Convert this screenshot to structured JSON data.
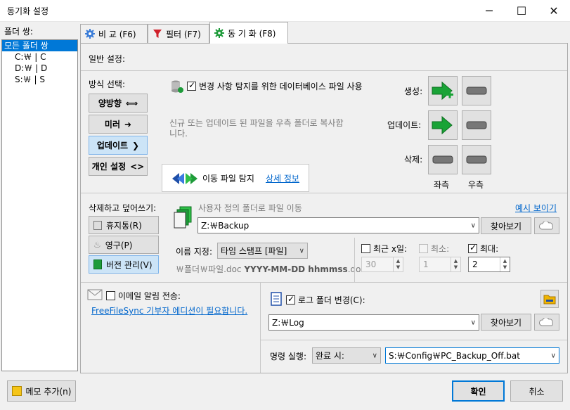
{
  "window": {
    "title": "동기화 설정",
    "minimize": "─",
    "maximize": "☐",
    "close": "✕"
  },
  "sidebar": {
    "label": "폴더 쌍:",
    "items": [
      "모든 폴더 쌍",
      "C:￦ | C",
      "D:￦ | D",
      "S:￦ | S"
    ]
  },
  "tabs": [
    {
      "label": "비  교 (F6)"
    },
    {
      "label": "필터 (F7)"
    },
    {
      "label": "동 기 화 (F8)"
    }
  ],
  "general": {
    "label": "일반 설정:"
  },
  "method": {
    "label": "방식 선택:",
    "buttons": [
      {
        "label": "양방향",
        "glyph": "⟺"
      },
      {
        "label": "미러",
        "glyph": "➜"
      },
      {
        "label": "업데이트",
        "glyph": "❯"
      },
      {
        "label": "개인 설정",
        "glyph": "<>"
      }
    ]
  },
  "db_option": {
    "label": "변경 사항 탐지를 위한 데이터베이스 파일 사용"
  },
  "description": "신규 또는 업데이트 된 파일을 우측 폴더로 복사합니다.",
  "move_detect": {
    "label": "이동 파일 탐지",
    "link": "상세 정보"
  },
  "actions": {
    "create": "생성:",
    "update": "업데이트:",
    "delete": "삭제:",
    "left": "좌측",
    "right": "우측"
  },
  "deletion": {
    "label": "삭제하고 덮어쓰기:",
    "buttons": [
      "휴지통(R)",
      "영구(P)",
      "버전 관리(V)"
    ],
    "move_label": "사용자 정의 폴더로 파일 이동",
    "example_link": "예시 보이기",
    "path": "Z:￦Backup",
    "browse": "찾아보기",
    "naming_label": "이름 지정:",
    "naming_value": "타임 스탬프 [파일]",
    "pattern_prefix": "￦폴더￦파일.doc ",
    "pattern_bold": "YYYY-MM-DD hhmmss",
    "pattern_suffix": ".doc",
    "last_label": "최근 x일:",
    "min_label": "최소:",
    "max_label": "최대:",
    "last_value": "30",
    "min_value": "1",
    "max_value": "2"
  },
  "email": {
    "label": "이메일 알림 전송:",
    "link": "FreeFileSync 기부자 에디션이 필요합니다."
  },
  "log": {
    "label": "로그 폴더 변경(C):",
    "path": "Z:￦Log",
    "browse": "찾아보기"
  },
  "command": {
    "label": "명령 실행:",
    "when": "완료 시:",
    "value": "S:￦Config￦PC_Backup_Off.bat"
  },
  "footer": {
    "memo": "메모 추가(n)",
    "ok": "확인",
    "cancel": "취소"
  }
}
